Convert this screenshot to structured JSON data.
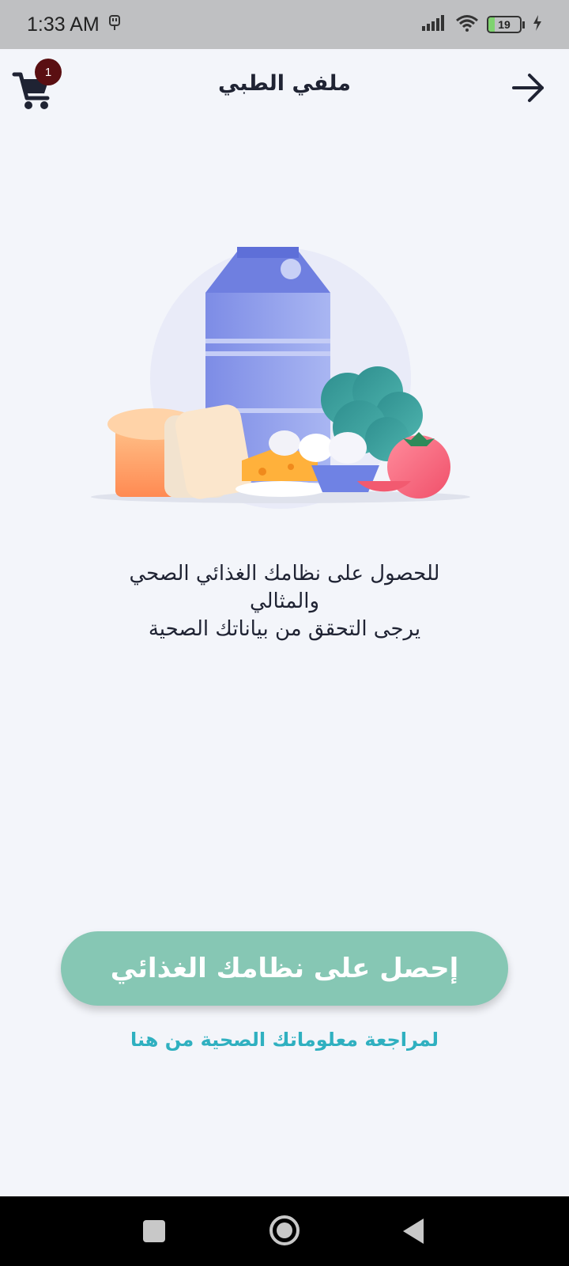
{
  "status_bar": {
    "time": "1:33 AM",
    "battery_level": "19",
    "icons": [
      "usb-icon",
      "signal-icon",
      "wifi-icon",
      "battery-icon",
      "charging-icon"
    ]
  },
  "header": {
    "title": "ملفي الطبي",
    "cart_count": "1"
  },
  "message": {
    "line1": "للحصول على نظامك الغذائي الصحي",
    "line2": "والمثالي",
    "line3": "يرجى التحقق من بياناتك الصحية"
  },
  "actions": {
    "primary_label": "إحصل على نظامك الغذائي",
    "review_link": "لمراجعة معلوماتك الصحية من هنا"
  },
  "colors": {
    "background": "#f3f5fa",
    "primary_button": "#86c7b4",
    "link": "#2fb0c0",
    "badge": "#5a0f12"
  }
}
